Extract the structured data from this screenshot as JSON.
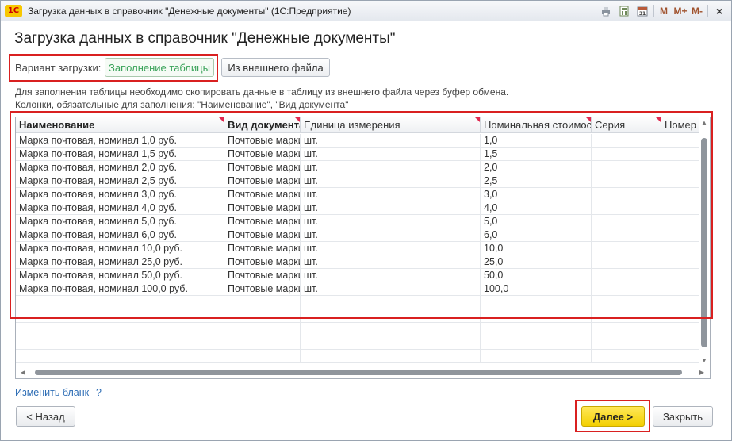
{
  "window": {
    "app_icon": "1С",
    "title": "Загрузка данных в справочник \"Денежные документы\" (1С:Предприятие)",
    "m_labels": [
      "M",
      "M+",
      "M-"
    ],
    "close_glyph": "×"
  },
  "form": {
    "title": "Загрузка данных в справочник \"Денежные документы\"",
    "variant_label": "Вариант загрузки:",
    "variant_options": [
      "Заполнение таблицы",
      "Из внешнего файла"
    ],
    "info_line1": "Для заполнения таблицы необходимо скопировать данные в таблицу из внешнего файла через буфер обмена.",
    "info_line2": "Колонки, обязательные для заполнения: \"Наименование\", \"Вид документа\""
  },
  "table": {
    "columns": [
      "Наименование",
      "Вид документа",
      "Единица измерения",
      "Номинальная стоимость",
      "Серия",
      "Номер"
    ],
    "rows": [
      [
        "Марка почтовая, номинал 1,0 руб.",
        "Почтовые марки",
        "шт.",
        "1,0",
        "",
        ""
      ],
      [
        "Марка почтовая, номинал 1,5 руб.",
        "Почтовые марки",
        "шт.",
        "1,5",
        "",
        ""
      ],
      [
        "Марка почтовая, номинал 2,0 руб.",
        "Почтовые марки",
        "шт.",
        "2,0",
        "",
        ""
      ],
      [
        "Марка почтовая, номинал 2,5 руб.",
        "Почтовые марки",
        "шт.",
        "2,5",
        "",
        ""
      ],
      [
        "Марка почтовая, номинал 3,0 руб.",
        "Почтовые марки",
        "шт.",
        "3,0",
        "",
        ""
      ],
      [
        "Марка почтовая, номинал 4,0 руб.",
        "Почтовые марки",
        "шт.",
        "4,0",
        "",
        ""
      ],
      [
        "Марка почтовая, номинал 5,0 руб.",
        "Почтовые марки",
        "шт.",
        "5,0",
        "",
        ""
      ],
      [
        "Марка почтовая, номинал 6,0 руб.",
        "Почтовые марки",
        "шт.",
        "6,0",
        "",
        ""
      ],
      [
        "Марка почтовая, номинал 10,0 руб.",
        "Почтовые марки",
        "шт.",
        "10,0",
        "",
        ""
      ],
      [
        "Марка почтовая, номинал 25,0 руб.",
        "Почтовые марки",
        "шт.",
        "25,0",
        "",
        ""
      ],
      [
        "Марка почтовая, номинал 50,0 руб.",
        "Почтовые марки",
        "шт.",
        "50,0",
        "",
        ""
      ],
      [
        "Марка почтовая, номинал 100,0 руб.",
        "Почтовые марки",
        "шт.",
        "100,0",
        "",
        ""
      ],
      [
        "",
        "",
        "",
        "",
        "",
        ""
      ],
      [
        "",
        "",
        "",
        "",
        "",
        ""
      ],
      [
        "",
        "",
        "",
        "",
        "",
        ""
      ],
      [
        "",
        "",
        "",
        "",
        "",
        ""
      ],
      [
        "",
        "",
        "",
        "",
        "",
        ""
      ]
    ]
  },
  "footer": {
    "change_template": "Изменить бланк",
    "help": "?",
    "back": "< Назад",
    "next": "Далее >",
    "close": "Закрыть"
  },
  "colors": {
    "highlight": "#d92020",
    "active_variant": "#3aa35a",
    "link": "#2d6db5",
    "next_button": "#f3cf00",
    "required_marker": "#e0284f"
  }
}
